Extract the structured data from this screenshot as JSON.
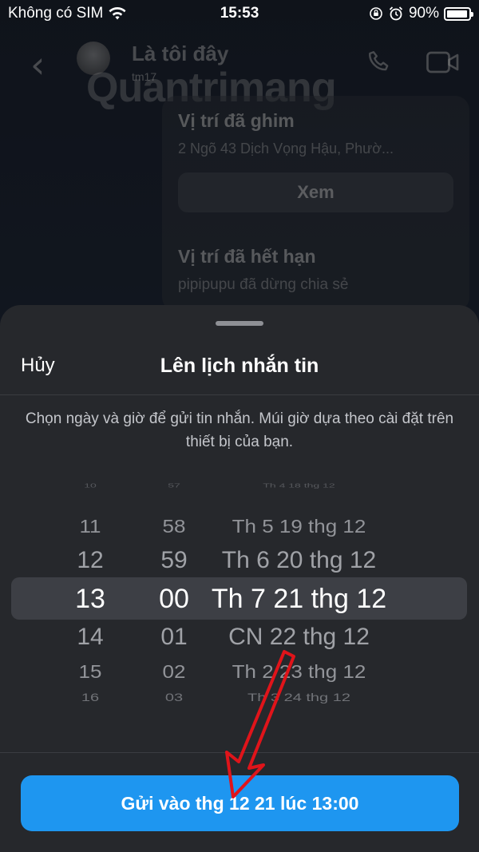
{
  "status_bar": {
    "carrier": "Không có SIM",
    "time": "15:53",
    "battery_pct": "90%",
    "battery_level": 0.9
  },
  "chat": {
    "contact_name": "Là tôi đây",
    "contact_sub": "tm17",
    "watermark": "Quantrimang",
    "pinned": {
      "title": "Vị trí đã ghim",
      "address": "2 Ngõ 43 Dịch Vọng Hậu, Phườ...",
      "view_label": "Xem",
      "expired_title": "Vị trí đã hết hạn",
      "expired_note": "pipipupu đã dừng chia sẻ"
    }
  },
  "sheet": {
    "cancel_label": "Hủy",
    "title": "Lên lịch nhắn tin",
    "description": "Chọn ngày và giờ để gửi tin nhắn. Múi giờ dựa theo cài đặt trên thiết bị của bạn.",
    "picker_rows": [
      {
        "hour": "10",
        "minute": "57",
        "date": "Th 4 18 thg 12"
      },
      {
        "hour": "11",
        "minute": "58",
        "date": "Th 5 19 thg 12"
      },
      {
        "hour": "12",
        "minute": "59",
        "date": "Th 6 20 thg 12"
      },
      {
        "hour": "13",
        "minute": "00",
        "date": "Th 7 21 thg 12"
      },
      {
        "hour": "14",
        "minute": "01",
        "date": "CN 22 thg 12"
      },
      {
        "hour": "15",
        "minute": "02",
        "date": "Th 2 23 thg 12"
      },
      {
        "hour": "16",
        "minute": "03",
        "date": "Th 3 24 thg 12"
      }
    ],
    "send_label": "Gửi vào thg 12 21 lúc 13:00"
  },
  "colors": {
    "accent": "#1e96f0",
    "annotation_arrow": "#e0141a",
    "sheet_bg": "#26282c"
  }
}
